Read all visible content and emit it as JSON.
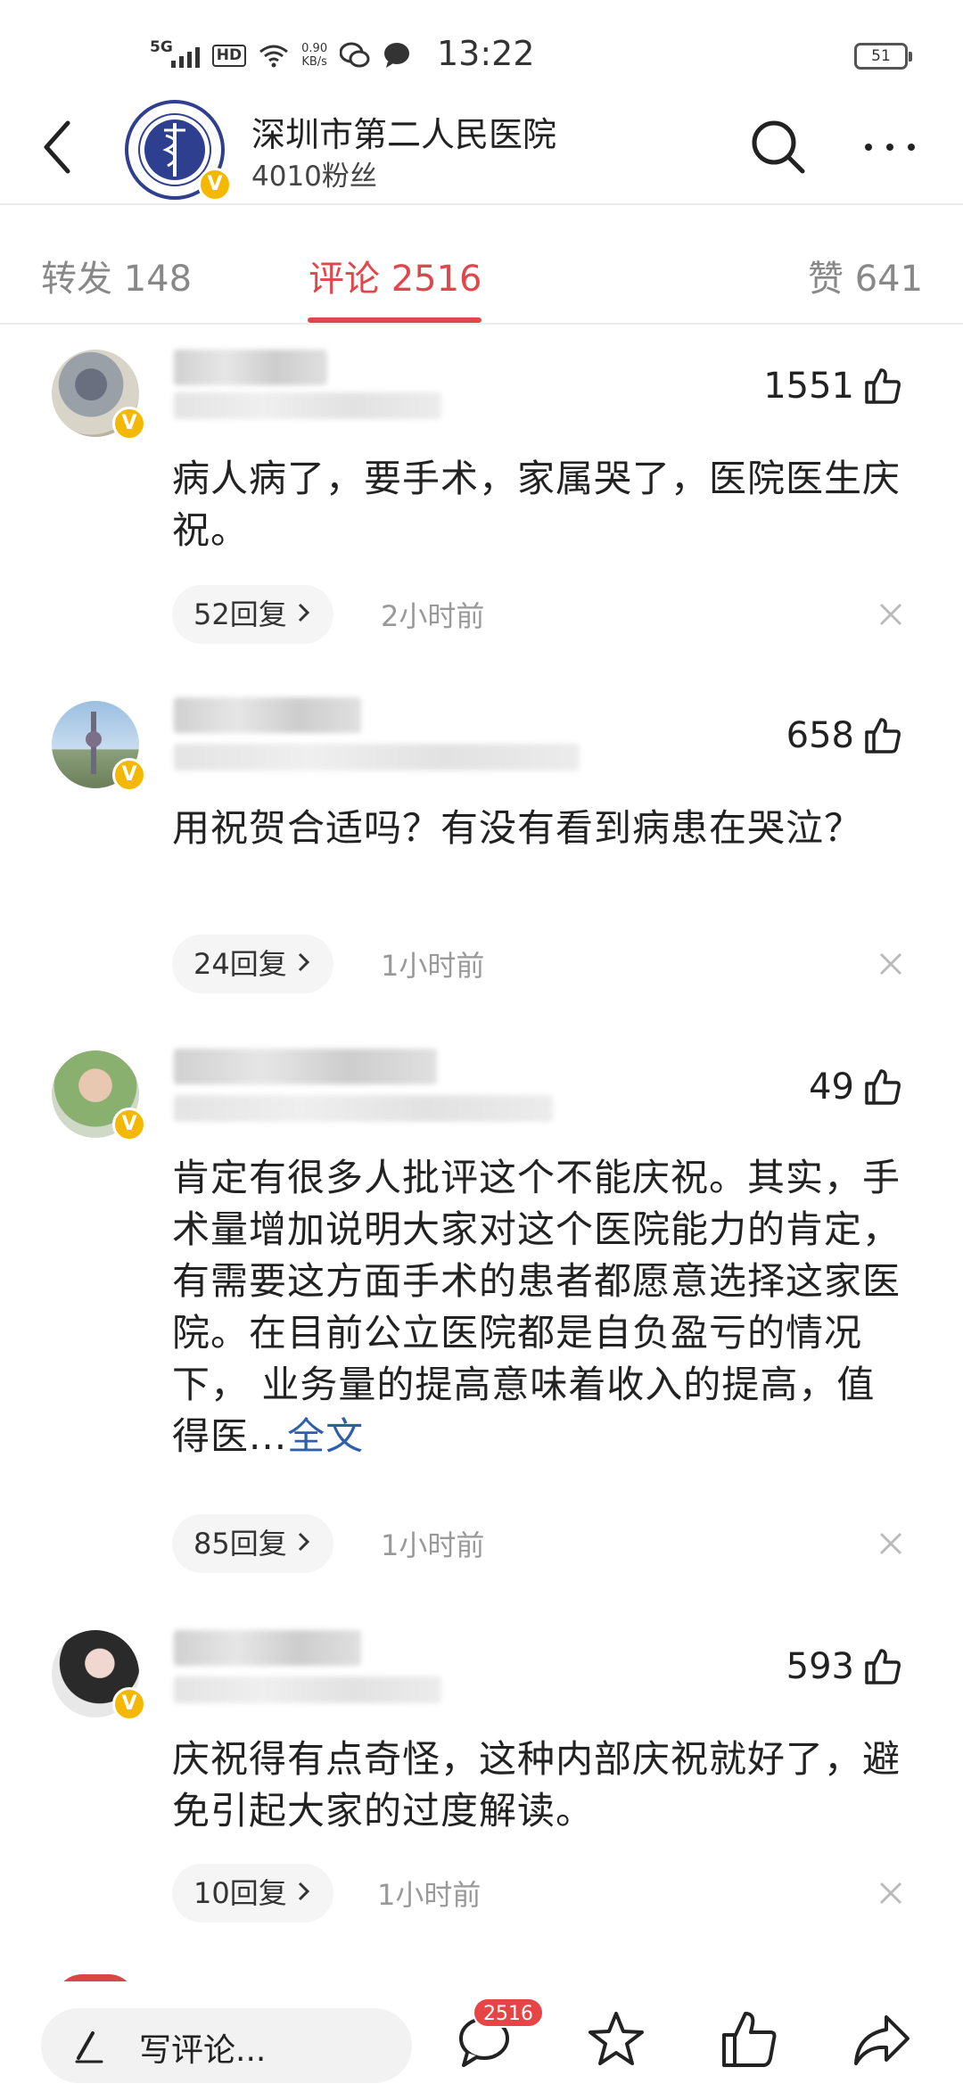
{
  "status_bar": {
    "network": "5G",
    "hd": "HD",
    "speed_value": "0.90",
    "speed_unit": "KB/s",
    "time": "13:22",
    "battery": "51",
    "battery_level": 0.51
  },
  "header": {
    "title": "深圳市第二人民医院",
    "fans": "4010粉丝"
  },
  "tabs": [
    {
      "label": "转发 148"
    },
    {
      "label": "评论 2516"
    },
    {
      "label": "赞 641"
    }
  ],
  "comments": [
    {
      "likes": "1551",
      "text": "病人病了，要手术，家属哭了，医院医生庆祝。",
      "replies": "52回复",
      "time": "2小时前"
    },
    {
      "likes": "658",
      "text": "用祝贺合适吗？有没有看到病患在哭泣？",
      "replies": "24回复",
      "time": "1小时前"
    },
    {
      "likes": "49",
      "text": "肯定有很多人批评这个不能庆祝。其实，手术量增加说明大家对这个医院能力的肯定，有需要这方面手术的患者都愿意选择这家医院。在目前公立医院都是自负盈亏的情况下， 业务量的提高意味着收入的提高，值得医...",
      "more_label": "全文",
      "replies": "85回复",
      "time": "1小时前"
    },
    {
      "likes": "593",
      "text": "庆祝得有点奇怪，这种内部庆祝就好了，避免引起大家的过度解读。",
      "replies": "10回复",
      "time": "1小时前"
    }
  ],
  "bottom_bar": {
    "input_placeholder": "写评论...",
    "comment_badge": "2516"
  },
  "colors": {
    "accent": "#e0474c",
    "verified": "#f5b800",
    "link": "#2f5fa8",
    "badge": "#e64545"
  },
  "icons": [
    "back-icon",
    "search-icon",
    "more-icon",
    "thumbs-up-icon",
    "chevron-right-icon",
    "close-icon",
    "pen-icon",
    "comment-icon",
    "star-icon",
    "share-icon"
  ]
}
